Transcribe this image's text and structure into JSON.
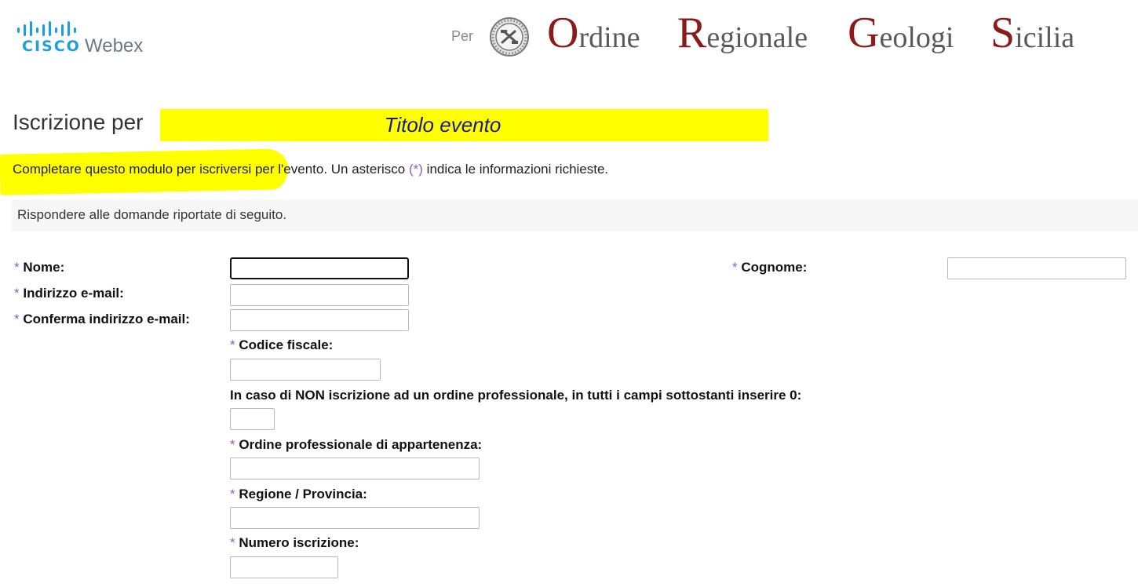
{
  "header": {
    "cisco_word": "CISCO",
    "webex_word": "Webex",
    "per_label": "Per",
    "brand": [
      {
        "cap": "O",
        "rest": "rdine"
      },
      {
        "cap": "R",
        "rest": "egionale"
      },
      {
        "cap": "G",
        "rest": "eologi"
      },
      {
        "cap": "S",
        "rest": "icilia"
      }
    ],
    "brand_color": "#8b1a1a"
  },
  "title": {
    "prefix": "Iscrizione per",
    "event": "Titolo evento",
    "highlight_color": "#ffff00"
  },
  "intro": {
    "part1": "Completare questo modulo per iscriversi",
    "part2": " per l'evento. Un asterisco ",
    "asterisk": "(*)",
    "part3": " indica le informazioni richieste."
  },
  "info_bar": "Rispondere alle domande riportate di seguito.",
  "form": {
    "asterisk": "*",
    "nome": {
      "label": "Nome:",
      "value": ""
    },
    "cognome": {
      "label": "Cognome:",
      "value": ""
    },
    "email": {
      "label": "Indirizzo e-mail:",
      "value": ""
    },
    "email_confirm": {
      "label": "Conferma indirizzo e-mail:",
      "value": ""
    },
    "codice_fiscale": {
      "label": "Codice fiscale:",
      "value": ""
    },
    "non_iscrizione": {
      "label": "In caso di NON iscrizione ad un ordine professionale, in tutti i campi sottostanti inserire 0:",
      "value": ""
    },
    "ordine": {
      "label": "Ordine professionale di appartenenza:",
      "value": ""
    },
    "regione": {
      "label": "Regione / Provincia:",
      "value": ""
    },
    "numero": {
      "label": "Numero iscrizione:",
      "value": ""
    }
  }
}
